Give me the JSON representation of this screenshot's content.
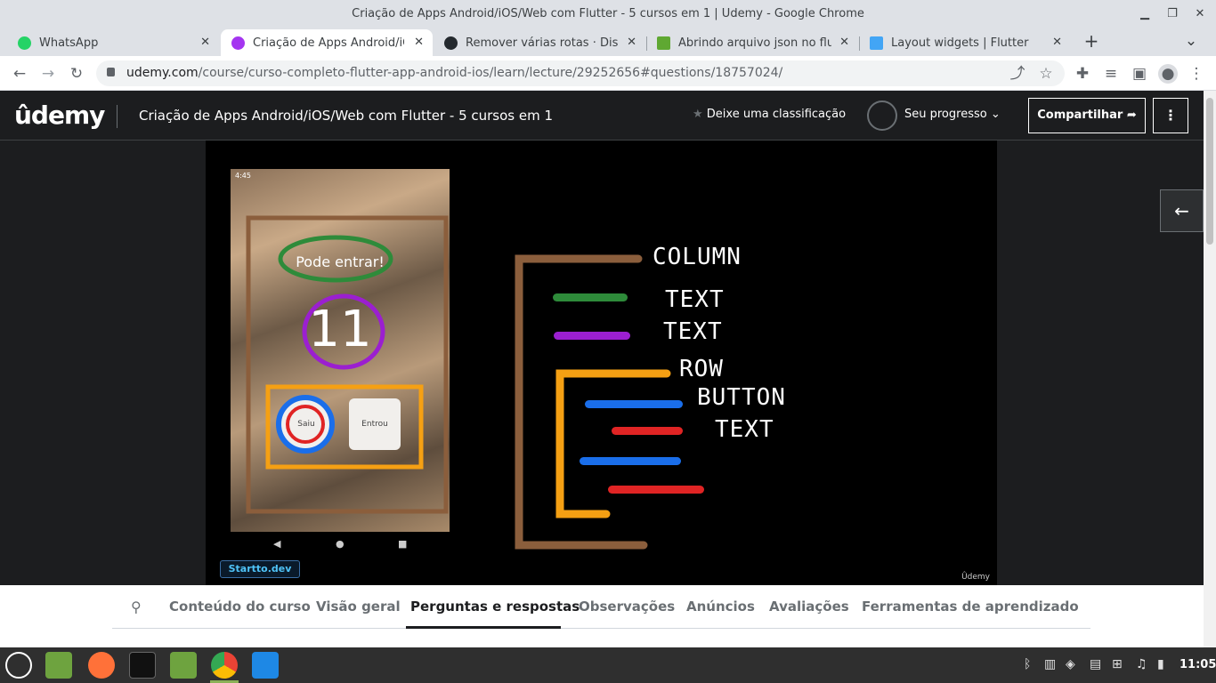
{
  "window": {
    "title": "Criação de Apps Android/iOS/Web com Flutter - 5 cursos em 1 | Udemy - Google Chrome"
  },
  "tabs": [
    {
      "label": "WhatsApp",
      "icon": "whatsapp-icon",
      "color": "#25d366"
    },
    {
      "label": "Criação de Apps Android/iOS/",
      "icon": "udemy-icon",
      "color": "#a435f0"
    },
    {
      "label": "Remover várias rotas · Discuss",
      "icon": "github-icon",
      "color": "#24292e"
    },
    {
      "label": "Abrindo arquivo json no flutte",
      "icon": "stackoverflow-icon",
      "color": "#5fa832"
    },
    {
      "label": "Layout widgets | Flutter",
      "icon": "flutter-icon",
      "color": "#42a5f5"
    }
  ],
  "omnibox": {
    "domain": "udemy.com",
    "path": "/course/curso-completo-flutter-app-android-ios/learn/lecture/29252656#questions/18757024/"
  },
  "udemy": {
    "logo": "ûdemy",
    "course_title": "Criação de Apps Android/iOS/Web com Flutter - 5 cursos em 1",
    "rate_label": "Deixe uma classificação",
    "progress_label": "Seu progresso",
    "share_label": "Compartilhar",
    "more_label": "⋮",
    "side_button": "←"
  },
  "video": {
    "status": "4:45",
    "pode_entrar": "Pode entrar!",
    "counter": "11",
    "btn_saiu": "Saiu",
    "btn_entrou": "Entrou",
    "startto": "Startto.dev",
    "watermark": "Ûdemy",
    "hand": {
      "column": "COLUMN",
      "text1": "TEXT",
      "text2": "TEXT",
      "row": "ROW",
      "button": "BUTTON",
      "text3": "TEXT"
    }
  },
  "course_tabs": [
    {
      "label": "Conteúdo do curso",
      "active": false
    },
    {
      "label": "Visão geral",
      "active": false
    },
    {
      "label": "Perguntas e respostas",
      "active": true
    },
    {
      "label": "Observações",
      "active": false
    },
    {
      "label": "Anúncios",
      "active": false
    },
    {
      "label": "Avaliações",
      "active": false
    },
    {
      "label": "Ferramentas de aprendizado",
      "active": false
    }
  ],
  "taskbar": {
    "clock": "11:05"
  },
  "colors": {
    "udemy_dark": "#1c1d1f",
    "accent_purple": "#a435f0",
    "brown": "#8b5e3c",
    "green": "#2e8b3a",
    "purple": "#9b1fd0",
    "orange": "#f5a013",
    "blue": "#1a6eea",
    "red": "#e02424"
  }
}
